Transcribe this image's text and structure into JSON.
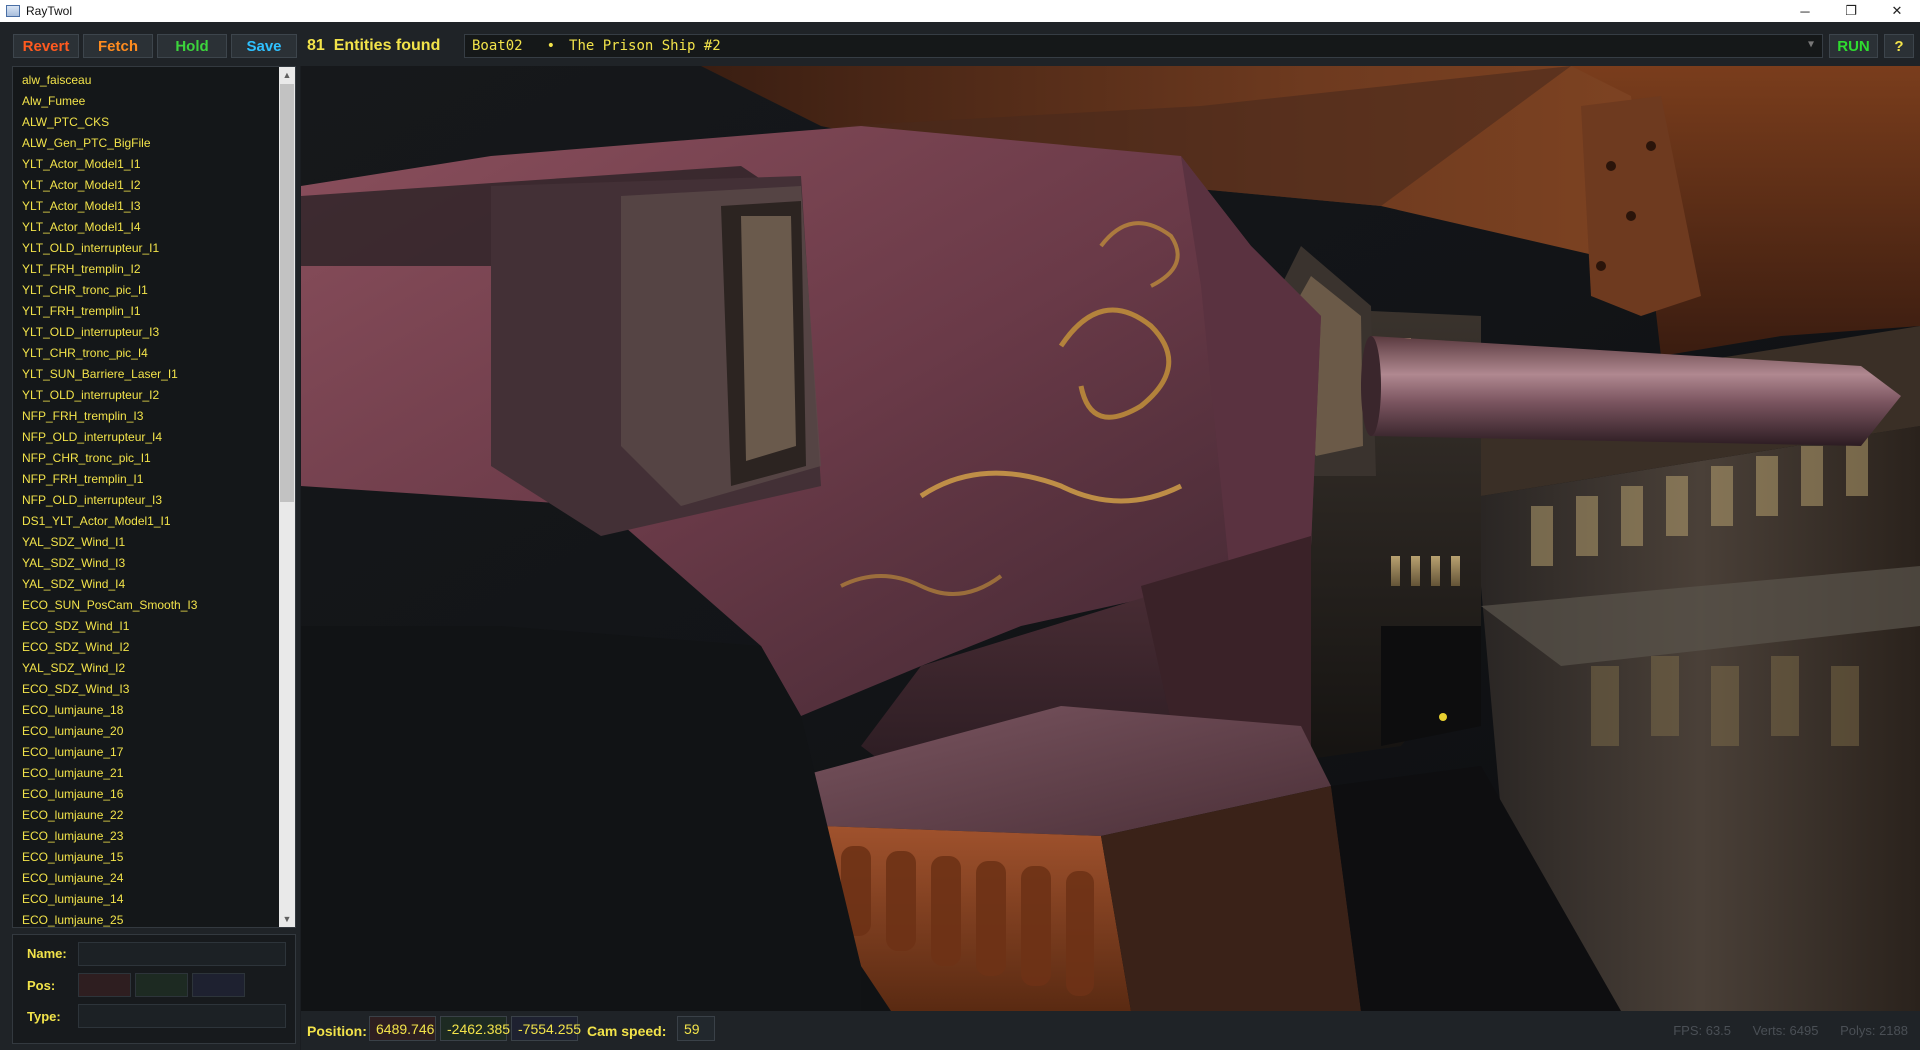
{
  "window": {
    "title": "RayTwol",
    "minimize": "─",
    "maximize": "❐",
    "close": "✕"
  },
  "toolbar": {
    "revert": "Revert",
    "fetch": "Fetch",
    "hold": "Hold",
    "save": "Save",
    "entity_count": "81",
    "entities_found": "Entities found",
    "level_code": "Boat02",
    "level_separator": "•",
    "level_name": "The Prison Ship #2",
    "run": "RUN",
    "help": "?",
    "colors": {
      "revert": "#ff5a1f",
      "fetch": "#ff8c1f",
      "hold": "#3cd43c",
      "save": "#2fc1ff"
    }
  },
  "entities": [
    "alw_faisceau",
    "Alw_Fumee",
    "ALW_PTC_CKS",
    "ALW_Gen_PTC_BigFile",
    "YLT_Actor_Model1_I1",
    "YLT_Actor_Model1_I2",
    "YLT_Actor_Model1_I3",
    "YLT_Actor_Model1_I4",
    "YLT_OLD_interrupteur_I1",
    "YLT_FRH_tremplin_I2",
    "YLT_CHR_tronc_pic_I1",
    "YLT_FRH_tremplin_I1",
    "YLT_OLD_interrupteur_I3",
    "YLT_CHR_tronc_pic_I4",
    "YLT_SUN_Barriere_Laser_I1",
    "YLT_OLD_interrupteur_I2",
    "NFP_FRH_tremplin_I3",
    "NFP_OLD_interrupteur_I4",
    "NFP_CHR_tronc_pic_I1",
    "NFP_FRH_tremplin_I1",
    "NFP_OLD_interrupteur_I3",
    "DS1_YLT_Actor_Model1_I1",
    "YAL_SDZ_Wind_I1",
    "YAL_SDZ_Wind_I3",
    "YAL_SDZ_Wind_I4",
    "ECO_SUN_PosCam_Smooth_I3",
    "ECO_SDZ_Wind_I1",
    "ECO_SDZ_Wind_I2",
    "YAL_SDZ_Wind_I2",
    "ECO_SDZ_Wind_I3",
    "ECO_lumjaune_18",
    "ECO_lumjaune_20",
    "ECO_lumjaune_17",
    "ECO_lumjaune_21",
    "ECO_lumjaune_16",
    "ECO_lumjaune_22",
    "ECO_lumjaune_23",
    "ECO_lumjaune_15",
    "ECO_lumjaune_24",
    "ECO_lumjaune_14",
    "ECO_lumjaune_25"
  ],
  "properties": {
    "name_label": "Name:",
    "pos_label": "Pos:",
    "type_label": "Type:"
  },
  "status": {
    "position_label": "Position:",
    "pos_x": "6489.746",
    "pos_y": "-2462.385",
    "pos_z": "-7554.255",
    "cam_speed_label": "Cam speed:",
    "cam_speed": "59",
    "fps": "FPS: 63.5",
    "verts": "Verts: 6495",
    "polys": "Polys: 2188"
  }
}
